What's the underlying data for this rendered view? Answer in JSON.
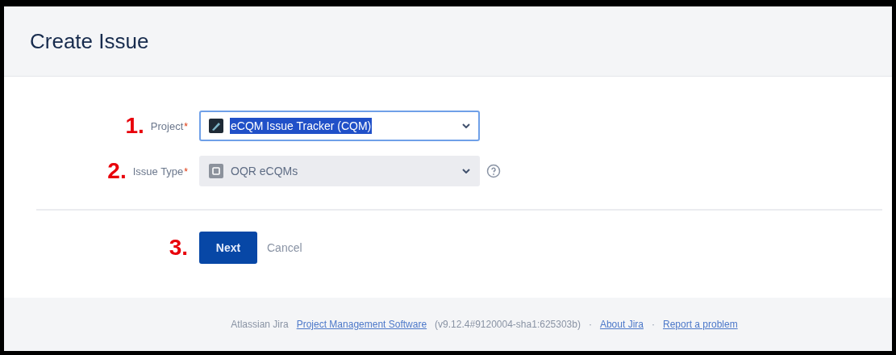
{
  "dialog": {
    "title": "Create Issue"
  },
  "fields": [
    {
      "step": "1.",
      "label": "Project",
      "required_mark": "*",
      "value": "eCQM Issue Tracker (CQM)",
      "text_selected": true,
      "disabled": false,
      "help": false
    },
    {
      "step": "2.",
      "label": "Issue Type",
      "required_mark": "*",
      "value": "OQR eCQMs",
      "text_selected": false,
      "disabled": true,
      "help": true
    }
  ],
  "actions": {
    "step": "3.",
    "primary": "Next",
    "cancel": "Cancel"
  },
  "footer": {
    "prefix": "Atlassian Jira",
    "link": "Project Management Software",
    "version": "(v9.12.4#9120004-sha1:625303b)",
    "separator": "·",
    "links": [
      "About Jira",
      "Report a problem"
    ]
  }
}
